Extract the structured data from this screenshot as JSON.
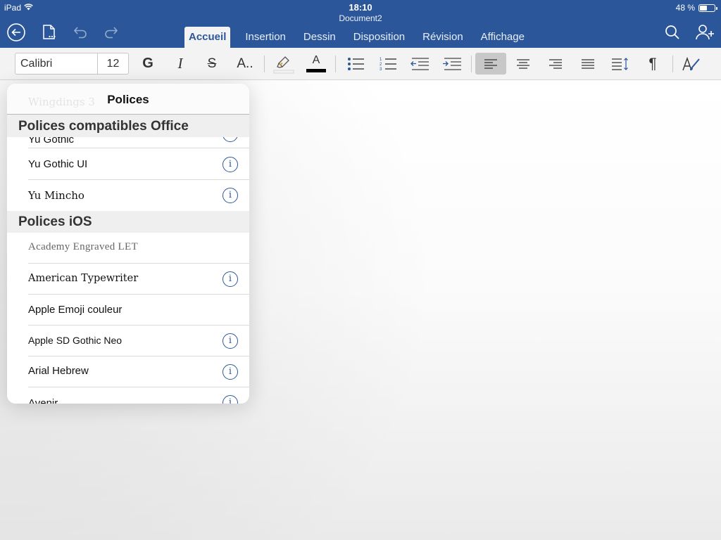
{
  "status": {
    "device": "iPad",
    "time": "18:10",
    "battery_text": "48 %",
    "battery_level": 0.48
  },
  "window": {
    "doc_title": "Document2"
  },
  "tabs": [
    {
      "label": "Accueil",
      "active": true
    },
    {
      "label": "Insertion"
    },
    {
      "label": "Dessin"
    },
    {
      "label": "Disposition"
    },
    {
      "label": "Révision"
    },
    {
      "label": "Affichage"
    }
  ],
  "ribbon": {
    "font_name": "Calibri",
    "font_size": "12",
    "bold": "G",
    "italic": "I",
    "strike": "S",
    "text_effects": "A..",
    "font_color_letter": "A",
    "pilcrow": "¶",
    "font_color": "#000000",
    "highlight_color": "#f2f2f2"
  },
  "popover": {
    "title": "Polices",
    "ghost_text": "Wingdings 3",
    "sections": [
      {
        "title": "Polices compatibles Office",
        "items": [
          {
            "label": "Yu Gothic",
            "info": true
          },
          {
            "label": "Yu Gothic UI",
            "info": true
          },
          {
            "label": "Yu Mincho",
            "info": true
          }
        ]
      },
      {
        "title": "Polices iOS",
        "items": [
          {
            "label": "Academy Engraved LET",
            "info": false
          },
          {
            "label": "American Typewriter",
            "info": true
          },
          {
            "label": "Apple Emoji couleur",
            "info": false
          },
          {
            "label": "Apple SD Gothic Neo",
            "info": true
          },
          {
            "label": "Arial Hebrew",
            "info": true
          },
          {
            "label": "Avenir",
            "info": true
          }
        ]
      }
    ],
    "info_glyph": "i"
  },
  "colors": {
    "brand": "#2b579a",
    "ribbon_bg": "#f3f3f3",
    "section_bg": "#efefef"
  }
}
